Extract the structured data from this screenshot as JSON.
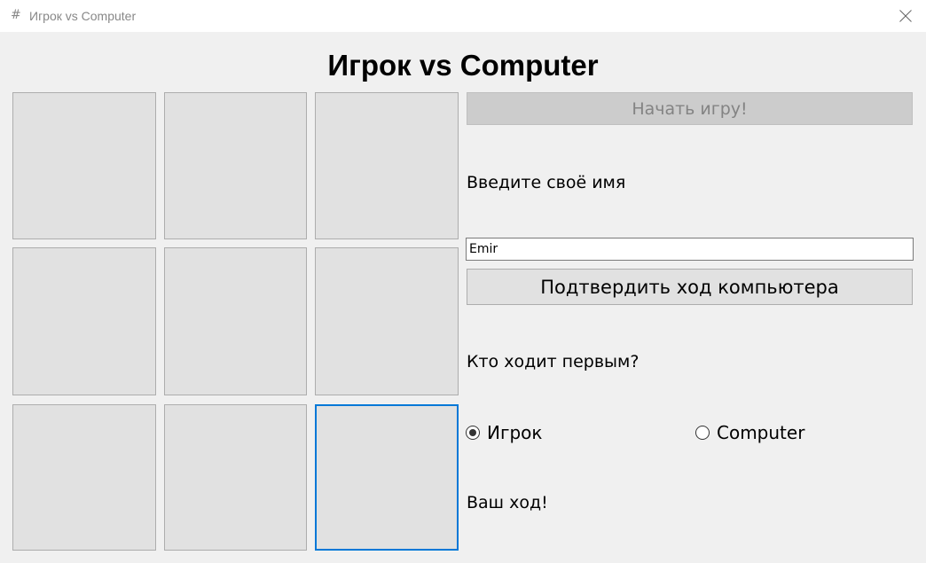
{
  "window": {
    "title": "Игрок vs Computer",
    "app_icon": "#",
    "close_glyph": "close-icon"
  },
  "heading": "Игрок vs Computer",
  "board": {
    "cells": [
      "",
      "",
      "",
      "",
      "",
      "",
      "",
      "",
      ""
    ],
    "focused_cell": 8
  },
  "controls": {
    "start_label": "Начать игру!",
    "start_enabled": false,
    "name_prompt": "Введите своё имя",
    "name_value": "Emir",
    "confirm_label": "Подтвердить ход компьютера",
    "first_move_prompt": "Кто ходит первым?",
    "options": [
      {
        "label": "Игрок",
        "checked": true
      },
      {
        "label": "Computer",
        "checked": false
      }
    ],
    "status": "Ваш ход!"
  },
  "colors": {
    "focus_accent": "#0078d7",
    "window_bg": "#f0f0f0",
    "cell_bg": "#e1e1e1"
  }
}
